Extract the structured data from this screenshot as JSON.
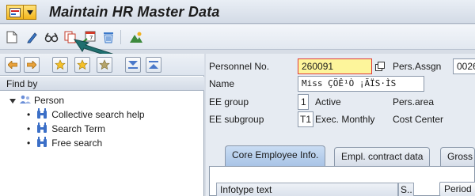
{
  "title_bar": {
    "title": "Maintain HR Master Data"
  },
  "toolbar": {
    "icons": [
      "create-icon",
      "change-icon",
      "display-icon",
      "copy-icon",
      "delimit-icon",
      "delete-icon",
      "overview-icon"
    ]
  },
  "left_pane": {
    "find_by_label": "Find by",
    "tree": {
      "root": {
        "label": "Person"
      },
      "children": [
        {
          "label": "Collective search help"
        },
        {
          "label": "Search Term"
        },
        {
          "label": "Free search"
        }
      ]
    }
  },
  "header": {
    "personnel_no": {
      "label": "Personnel No.",
      "value": "260091"
    },
    "pers_assign": {
      "label": "Pers.Assgn",
      "value": "0026"
    },
    "name": {
      "label": "Name",
      "value": "Miss ÇÖÊ¹Ò ¡ÃÏS·ÌS"
    },
    "ee_group": {
      "label": "EE group",
      "code": "1",
      "text": "Active"
    },
    "pers_area": {
      "label": "Pers.area"
    },
    "ee_subgroup": {
      "label": "EE subgroup",
      "code": "T1",
      "text": "Exec. Monthly"
    },
    "cost_center": {
      "label": "Cost Center"
    }
  },
  "tabs": [
    {
      "label": "Core Employee Info.",
      "active": true
    },
    {
      "label": "Empl. contract data",
      "active": false
    },
    {
      "label": "Gross",
      "active": false
    }
  ],
  "infotype_grid": {
    "columns": [
      "Infotype text",
      "S.."
    ],
    "period_button": "Period"
  },
  "colors": {
    "input_highlight": "#fdf59b",
    "focus_border": "#e03a3a",
    "arrow": "#1f6f6f"
  }
}
